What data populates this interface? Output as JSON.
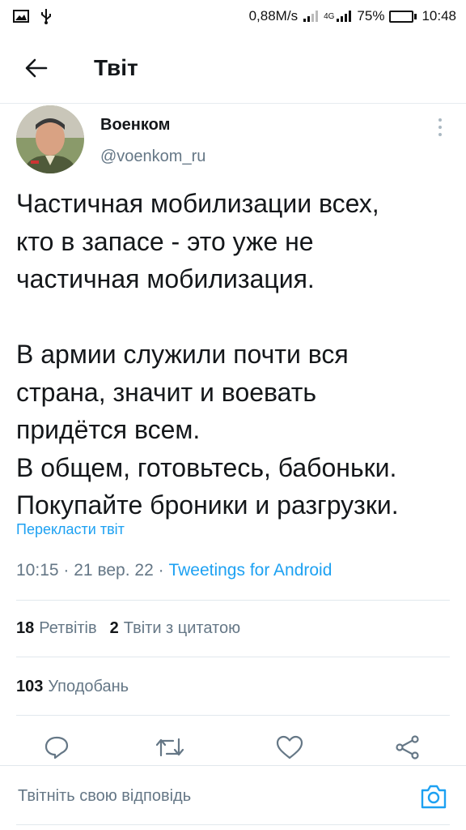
{
  "status_bar": {
    "speed": "0,88M/s",
    "network": "4G",
    "battery": "75%",
    "battery_level": 0.75,
    "time": "10:48"
  },
  "header": {
    "title": "Твіт",
    "back_icon": "arrow-left-icon"
  },
  "tweet": {
    "author_name": "Военком",
    "author_handle": "@voenkom_ru",
    "text_lines_1": [
      "Частичная мобилизации всех,",
      "кто в запасе - это уже не",
      "частичная мобилизация."
    ],
    "text_lines_2": [
      "В армии служили почти вся",
      "страна, значит и воевать",
      "придётся всем.",
      "В общем, готовьтесь, бабоньки.",
      "Покупайте броники и разгрузки."
    ],
    "translate_label": "Перекласти твіт",
    "time": "10:15",
    "date": "21 вер. 22",
    "separator": "·",
    "client": "Tweetings for Android"
  },
  "stats": {
    "retweets_count": "18",
    "retweets_label": "Ретвітів",
    "quotes_count": "2",
    "quotes_label": "Твіти з цитатою",
    "likes_count": "103",
    "likes_label": "Уподобань"
  },
  "actions": [
    "reply-icon",
    "retweet-icon",
    "like-icon",
    "share-icon"
  ],
  "reply": {
    "placeholder": "Твітніть свою відповідь",
    "camera_icon": "camera-icon"
  },
  "colors": {
    "accent": "#1da1f2",
    "secondary_text": "#657786",
    "primary_text": "#14171a",
    "battery_fill": "#3bbf3b"
  }
}
